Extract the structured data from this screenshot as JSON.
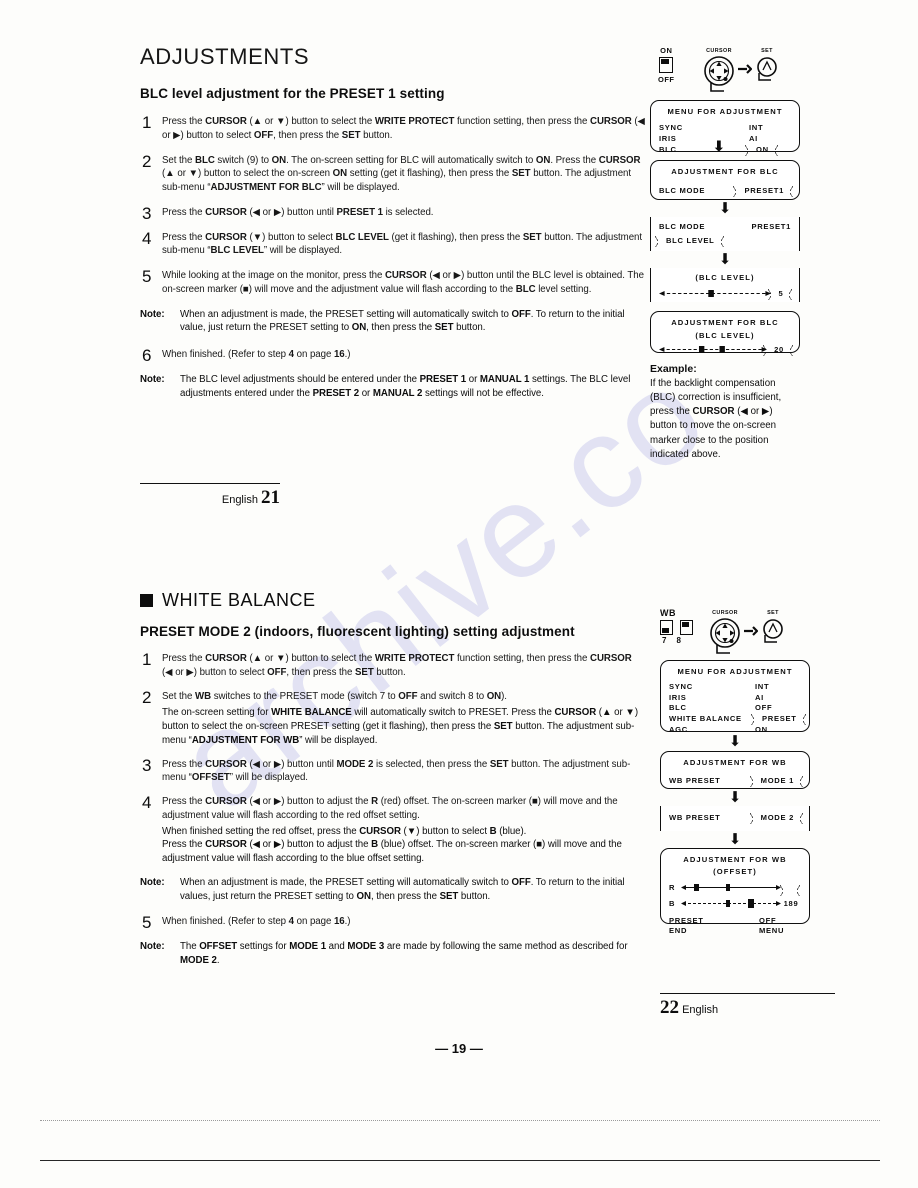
{
  "document": {
    "scan_page_number": "— 19 —",
    "watermark_text": "archive.co"
  },
  "page21": {
    "title": "ADJUSTMENTS",
    "subtitle": "BLC level adjustment for the PRESET 1 setting",
    "steps": [
      {
        "num": "1",
        "html": "Press the <b>CURSOR</b> (▲ or ▼) button to select the <b>WRITE PROTECT</b> function setting, then press the <b>CURSOR</b> (◀ or ▶) button to select <b>OFF</b>, then press the <b>SET</b> button."
      },
      {
        "num": "2",
        "html": "Set the <b>BLC</b> switch (9) to <b>ON</b>. The on-screen setting for BLC will automatically switch to <b>ON</b>. Press the <b>CURSOR</b> (▲ or ▼) button to select the on-screen <b>ON</b> setting (get it flashing), then press the <b>SET</b> button. The adjustment sub-menu “<b>ADJUSTMENT FOR BLC</b>” will be displayed."
      },
      {
        "num": "3",
        "html": "Press the <b>CURSOR</b> (◀ or ▶) button until <b>PRESET 1</b> is selected."
      },
      {
        "num": "4",
        "html": "Press the <b>CURSOR</b> (▼) button to select <b>BLC LEVEL</b> (get it flashing), then press the <b>SET</b> button. The adjustment sub-menu “<b>BLC LEVEL</b>” will be displayed."
      },
      {
        "num": "5",
        "html": "While looking at the image on the monitor, press the <b>CURSOR</b> (◀ or ▶) button until the BLC level is obtained. The on-screen marker (■) will move and the adjustment value will flash according to the <b>BLC</b> level setting."
      }
    ],
    "note1": {
      "label": "Note:",
      "html": "When an adjustment is made, the PRESET setting will automatically switch to <b>OFF</b>. To return to the initial value, just return the PRESET setting to <b>ON</b>, then press the <b>SET</b> button."
    },
    "step6": {
      "num": "6",
      "html": "When finished. (Refer to step <b>4</b> on page <b>16</b>.)"
    },
    "note2": {
      "label": "Note:",
      "html": "The BLC level adjustments should be entered under the <b>PRESET 1</b> or <b>MANUAL 1</b> settings. The BLC level adjustments entered under the <b>PRESET 2</b> or <b>MANUAL 2</b> settings will not be effective."
    },
    "footer": {
      "language": "English",
      "page": "21"
    },
    "diagram": {
      "switch_on": "ON",
      "switch_off": "OFF",
      "cursor_label": "CURSOR",
      "set_label": "SET",
      "menu": {
        "title": "MENU FOR ADJUSTMENT",
        "left_items": [
          "SYNC",
          "IRIS",
          "BLC"
        ],
        "right_items": [
          "INT",
          "AI",
          "ON"
        ],
        "flashing_item": "ON"
      },
      "panel_blc_mode": {
        "title": "ADJUSTMENT FOR BLC",
        "label": "BLC MODE",
        "value": "PRESET1",
        "flashing": true
      },
      "panel_blc_level_select": {
        "label": "BLC MODE",
        "value": "PRESET1",
        "sub_label": "BLC LEVEL",
        "flashing": true
      },
      "panel_level_slider": {
        "title": "(BLC LEVEL)",
        "value": "5",
        "marker_position_pct": 46
      },
      "panel_final": {
        "title": "ADJUSTMENT FOR BLC",
        "subtitle": "(BLC LEVEL)",
        "value": "20",
        "marker_position_pct": 40,
        "marker2_position_pct": 58
      },
      "example": {
        "heading": "Example:",
        "html": "If the backlight compensation (BLC) correction is insufficient, press the <b>CURSOR</b> (◀ or ▶) button to move the on-screen marker close to the position indicated above."
      }
    }
  },
  "page22": {
    "section_title": "WHITE BALANCE",
    "subtitle": "PRESET MODE 2 (indoors, fluorescent lighting) setting adjustment",
    "steps": [
      {
        "num": "1",
        "html": "Press the <b>CURSOR</b> (▲ or ▼) button to select the <b>WRITE PROTECT</b> function setting, then press the <b>CURSOR</b> (◀ or ▶) button to select <b>OFF</b>, then press the <b>SET</b> button."
      },
      {
        "num": "2",
        "html": "Set the <b>WB</b> switches to the PRESET mode (switch 7 to <b>OFF</b> and switch 8 to <b>ON</b>)."
      }
    ],
    "step2_cont": "The on-screen setting for <b>WHITE BALANCE</b> will automatically switch to PRESET. Press the <b>CURSOR</b> (▲ or ▼) button to select the on-screen PRESET setting (get it flashing), then press the <b>SET</b> button. The adjustment sub-menu “<b>ADJUSTMENT FOR WB</b>” will be displayed.",
    "steps_b": [
      {
        "num": "3",
        "html": "Press the <b>CURSOR</b> (◀ or ▶) button until <b>MODE 2</b> is selected, then press the <b>SET</b> button. The adjustment sub-menu “<b>OFFSET</b>” will be displayed."
      },
      {
        "num": "4",
        "html": "Press the <b>CURSOR</b> (◀ or ▶) button to adjust the <b>R</b> (red) offset. The on-screen marker (■) will move and the adjustment value will flash according to the red offset setting."
      }
    ],
    "step4_cont1": "When finished setting the red offset, press the <b>CURSOR</b> (▼) button to select <b>B</b> (blue).",
    "step4_cont2": "Press the <b>CURSOR</b> (◀ or ▶) button to adjust the <b>B</b> (blue) offset. The on-screen marker (■) will move and the adjustment value will flash according to the blue offset setting.",
    "note1": {
      "label": "Note:",
      "html": "When an adjustment is made, the PRESET setting will automatically switch to <b>OFF</b>. To return to the initial values, just return the PRESET setting to <b>ON</b>, then press the <b>SET</b> button."
    },
    "step5": {
      "num": "5",
      "html": "When finished. (Refer to step <b>4</b> on page <b>16</b>.)"
    },
    "note2": {
      "label": "Note:",
      "html": "The <b>OFFSET</b> settings for <b>MODE 1</b> and <b>MODE 3</b> are made by following the same method as described for <b>MODE 2</b>."
    },
    "footer": {
      "language": "English",
      "page": "22"
    },
    "diagram": {
      "wb_label": "WB",
      "switch_numbers": [
        "7",
        "8"
      ],
      "cursor_label": "CURSOR",
      "set_label": "SET",
      "menu": {
        "title": "MENU FOR ADJUSTMENT",
        "left_items": [
          "SYNC",
          "IRIS",
          "BLC",
          "WHITE BALANCE",
          "AGC"
        ],
        "right_items": [
          "INT",
          "AI",
          "OFF",
          "PRESET",
          "ON"
        ],
        "flashing_item": "PRESET"
      },
      "panel_wb_mode1": {
        "title": "ADJUSTMENT FOR WB",
        "label": "WB PRESET",
        "value": "MODE 1",
        "flashing": true
      },
      "panel_wb_mode2": {
        "label": "WB PRESET",
        "value": "MODE 2",
        "flashing": true
      },
      "panel_offset": {
        "title": "ADJUSTMENT FOR WB",
        "subtitle": "(OFFSET)",
        "rows": [
          {
            "label": "R",
            "value": "",
            "flashing": true,
            "marker_position_pct": 16,
            "marker2_position_pct": 48
          },
          {
            "label": "B",
            "value": "189",
            "flashing": false,
            "marker_position_pct": 48,
            "marker2_position_pct": 70
          }
        ],
        "bottom_left": [
          "PRESET",
          "END"
        ],
        "bottom_right": [
          "OFF",
          "MENU"
        ]
      }
    }
  }
}
